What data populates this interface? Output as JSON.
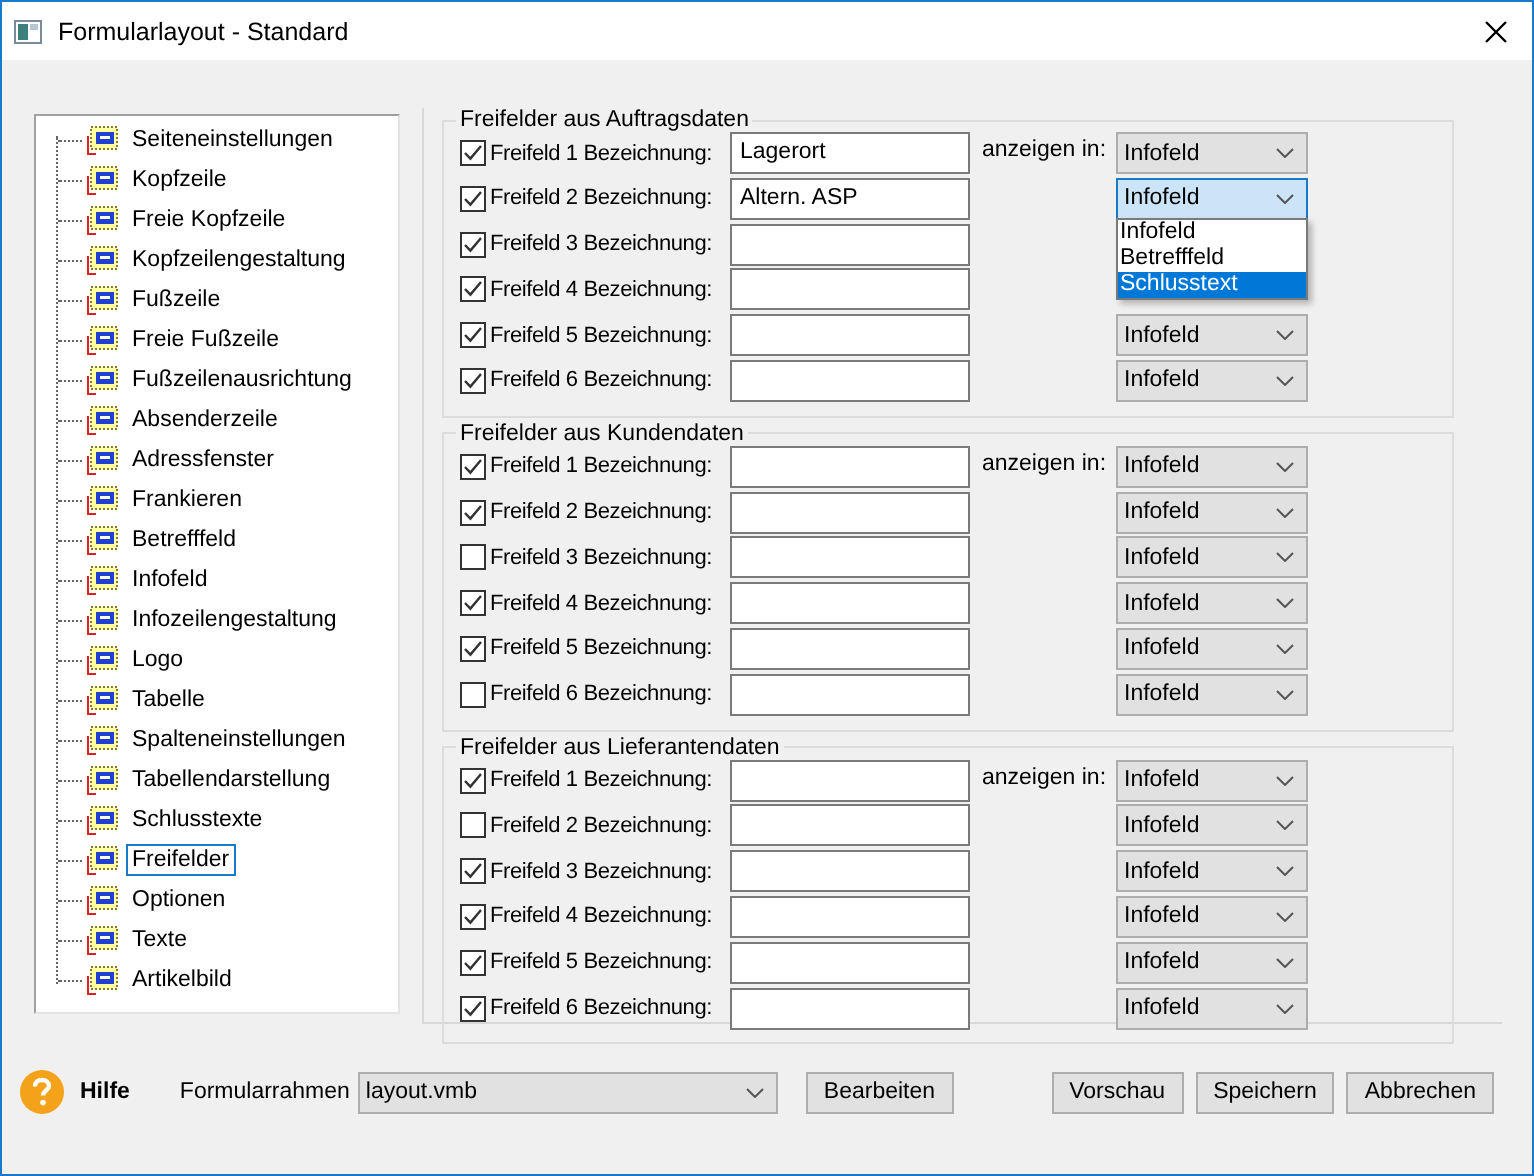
{
  "window": {
    "title": "Formularlayout - Standard"
  },
  "tree": {
    "items": [
      {
        "label": "Seiteneinstellungen",
        "selected": false
      },
      {
        "label": "Kopfzeile",
        "selected": false
      },
      {
        "label": "Freie Kopfzeile",
        "selected": false
      },
      {
        "label": "Kopfzeilengestaltung",
        "selected": false
      },
      {
        "label": "Fußzeile",
        "selected": false
      },
      {
        "label": "Freie Fußzeile",
        "selected": false
      },
      {
        "label": "Fußzeilenausrichtung",
        "selected": false
      },
      {
        "label": "Absenderzeile",
        "selected": false
      },
      {
        "label": "Adressfenster",
        "selected": false
      },
      {
        "label": "Frankieren",
        "selected": false
      },
      {
        "label": "Betrefffeld",
        "selected": false
      },
      {
        "label": "Infofeld",
        "selected": false
      },
      {
        "label": "Infozeilengestaltung",
        "selected": false
      },
      {
        "label": "Logo",
        "selected": false
      },
      {
        "label": "Tabelle",
        "selected": false
      },
      {
        "label": "Spalteneinstellungen",
        "selected": false
      },
      {
        "label": "Tabellendarstellung",
        "selected": false
      },
      {
        "label": "Schlusstexte",
        "selected": false
      },
      {
        "label": "Freifelder",
        "selected": true
      },
      {
        "label": "Optionen",
        "selected": false
      },
      {
        "label": "Texte",
        "selected": false
      },
      {
        "label": "Artikelbild",
        "selected": false
      }
    ]
  },
  "groups": [
    {
      "title": "Freifelder aus Auftragsdaten",
      "display_label": "anzeigen in:",
      "rows": [
        {
          "checked": true,
          "label": "Freifeld 1 Bezeichnung:",
          "value": "Lagerort",
          "display": "Infofeld"
        },
        {
          "checked": true,
          "label": "Freifeld 2 Bezeichnung:",
          "value": "Altern. ASP",
          "display": "Infofeld",
          "open": true,
          "options": [
            {
              "label": "Infofeld",
              "selected": false
            },
            {
              "label": "Betrefffeld",
              "selected": false
            },
            {
              "label": "Schlusstext",
              "selected": true
            }
          ]
        },
        {
          "checked": true,
          "label": "Freifeld 3 Bezeichnung:"
        },
        {
          "checked": true,
          "label": "Freifeld 4 Bezeichnung:"
        },
        {
          "checked": true,
          "label": "Freifeld 5 Bezeichnung:",
          "display": "Infofeld"
        },
        {
          "checked": true,
          "label": "Freifeld 6 Bezeichnung:",
          "display": "Infofeld"
        }
      ]
    },
    {
      "title": "Freifelder aus Kundendaten",
      "display_label": "anzeigen in:",
      "rows": [
        {
          "checked": true,
          "label": "Freifeld 1 Bezeichnung:",
          "display": "Infofeld"
        },
        {
          "checked": true,
          "label": "Freifeld 2 Bezeichnung:",
          "display": "Infofeld"
        },
        {
          "checked": false,
          "label": "Freifeld 3 Bezeichnung:",
          "display": "Infofeld"
        },
        {
          "checked": true,
          "label": "Freifeld 4 Bezeichnung:",
          "display": "Infofeld"
        },
        {
          "checked": true,
          "label": "Freifeld 5 Bezeichnung:",
          "display": "Infofeld"
        },
        {
          "checked": false,
          "label": "Freifeld 6 Bezeichnung:",
          "display": "Infofeld"
        }
      ]
    },
    {
      "title": "Freifelder aus Lieferantendaten",
      "display_label": "anzeigen in:",
      "rows": [
        {
          "checked": true,
          "label": "Freifeld 1 Bezeichnung:",
          "display": "Infofeld"
        },
        {
          "checked": false,
          "label": "Freifeld 2 Bezeichnung:",
          "display": "Infofeld"
        },
        {
          "checked": true,
          "label": "Freifeld 3 Bezeichnung:",
          "display": "Infofeld"
        },
        {
          "checked": true,
          "label": "Freifeld 4 Bezeichnung:",
          "display": "Infofeld"
        },
        {
          "checked": true,
          "label": "Freifeld 5 Bezeichnung:",
          "display": "Infofeld"
        },
        {
          "checked": true,
          "label": "Freifeld 6 Bezeichnung:",
          "display": "Infofeld"
        }
      ]
    }
  ],
  "footer": {
    "help": "Hilfe",
    "frame_label": "Formularrahmen",
    "frame_value": "layout.vmb",
    "edit_button": "Bearbeiten",
    "buttons": [
      "Vorschau",
      "Speichern",
      "Abbrechen"
    ]
  }
}
